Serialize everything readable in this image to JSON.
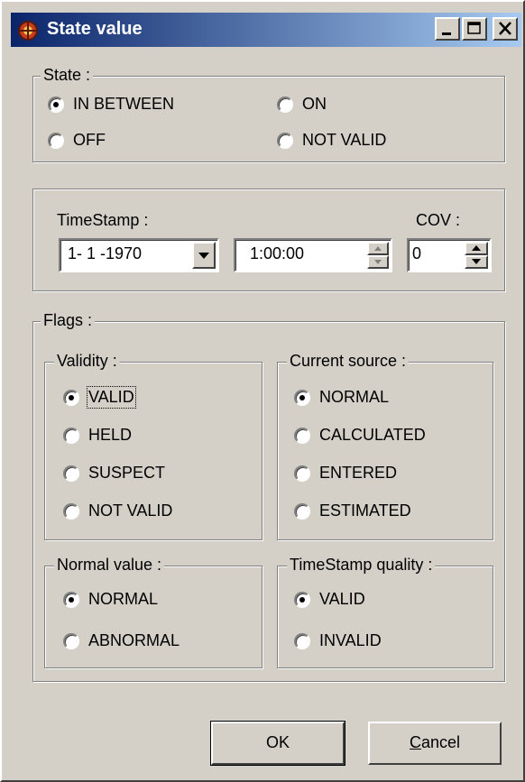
{
  "window": {
    "title": "State value"
  },
  "state": {
    "legend": "State :",
    "options": [
      "IN BETWEEN",
      "ON",
      "OFF",
      "NOT VALID"
    ],
    "selected": "IN BETWEEN"
  },
  "timestamp": {
    "label": "TimeStamp :",
    "date": "1- 1 -1970",
    "time": "1:00:00",
    "cov_label": "COV :",
    "cov": "0"
  },
  "flags": {
    "legend": "Flags :",
    "validity": {
      "legend": "Validity :",
      "options": [
        "VALID",
        "HELD",
        "SUSPECT",
        "NOT VALID"
      ],
      "selected": "VALID"
    },
    "current_source": {
      "legend": "Current source :",
      "options": [
        "NORMAL",
        "CALCULATED",
        "ENTERED",
        "ESTIMATED"
      ],
      "selected": "NORMAL"
    },
    "normal_value": {
      "legend": "Normal value :",
      "options": [
        "NORMAL",
        "ABNORMAL"
      ],
      "selected": "NORMAL"
    },
    "timestamp_quality": {
      "legend": "TimeStamp quality :",
      "options": [
        "VALID",
        "INVALID"
      ],
      "selected": "VALID"
    }
  },
  "buttons": {
    "ok": "OK",
    "cancel": "Cancel"
  }
}
